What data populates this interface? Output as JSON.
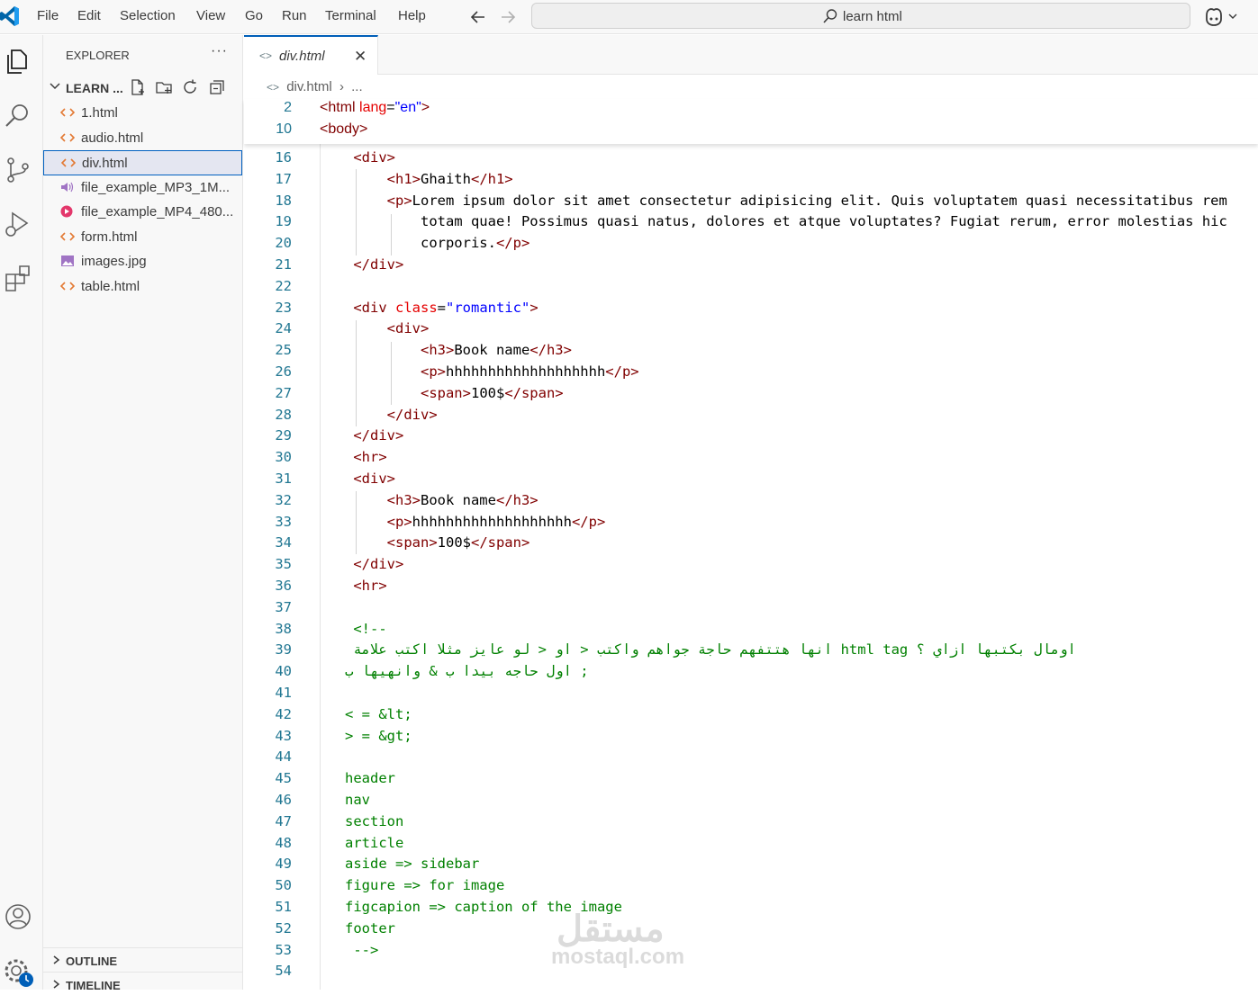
{
  "app": {
    "search_text": "learn html"
  },
  "menu": [
    "File",
    "Edit",
    "Selection",
    "View",
    "Go",
    "Run",
    "Terminal",
    "Help"
  ],
  "explorer": {
    "title": "EXPLORER",
    "more": "···",
    "folder": "LEARN ...",
    "files": [
      {
        "name": "1.html",
        "icon": "html-file-icon"
      },
      {
        "name": "audio.html",
        "icon": "html-file-icon"
      },
      {
        "name": "div.html",
        "icon": "html-file-icon",
        "selected": true
      },
      {
        "name": "file_example_MP3_1M...",
        "icon": "audio-file-icon"
      },
      {
        "name": "file_example_MP4_480...",
        "icon": "video-file-icon"
      },
      {
        "name": "form.html",
        "icon": "html-file-icon"
      },
      {
        "name": "images.jpg",
        "icon": "image-file-icon"
      },
      {
        "name": "table.html",
        "icon": "html-file-icon"
      }
    ],
    "outline": "OUTLINE",
    "timeline": "TIMELINE"
  },
  "tab": {
    "label": "div.html",
    "icon": "<>",
    "close": "✕"
  },
  "breadcrumb": {
    "file": "div.html",
    "sep": "›",
    "rest": "..."
  },
  "sticky_lines": [
    {
      "n": "2",
      "html": "<span class=\"t\">&lt;html</span> <span class=\"a\">lang</span>=<span class=\"s\">\"en\"</span><span class=\"t\">&gt;</span>"
    },
    {
      "n": "10",
      "html": "<span class=\"t\">&lt;body&gt;</span>"
    }
  ],
  "code_lines": [
    {
      "n": "16",
      "html": "    <span class=\"t\">&lt;div&gt;</span>"
    },
    {
      "n": "17",
      "html": "        <span class=\"t\">&lt;h1&gt;</span>Ghaith<span class=\"t\">&lt;/h1&gt;</span>"
    },
    {
      "n": "18",
      "html": "        <span class=\"t\">&lt;p&gt;</span>Lorem ipsum dolor sit amet consectetur adipisicing elit. Quis voluptatem quasi necessitatibus rem"
    },
    {
      "n": "19",
      "html": "            totam quae! Possimus quasi natus, dolores et atque voluptates? Fugiat rerum, error molestias hic"
    },
    {
      "n": "20",
      "html": "            corporis.<span class=\"t\">&lt;/p&gt;</span>"
    },
    {
      "n": "21",
      "html": "    <span class=\"t\">&lt;/div&gt;</span>"
    },
    {
      "n": "22",
      "html": ""
    },
    {
      "n": "23",
      "html": "    <span class=\"t\">&lt;div</span> <span class=\"a\">class</span>=<span class=\"s\">\"romantic\"</span><span class=\"t\">&gt;</span>"
    },
    {
      "n": "24",
      "html": "        <span class=\"t\">&lt;div&gt;</span>"
    },
    {
      "n": "25",
      "html": "            <span class=\"t\">&lt;h3&gt;</span>Book name<span class=\"t\">&lt;/h3&gt;</span>"
    },
    {
      "n": "26",
      "html": "            <span class=\"t\">&lt;p&gt;</span>hhhhhhhhhhhhhhhhhhh<span class=\"t\">&lt;/p&gt;</span>"
    },
    {
      "n": "27",
      "html": "            <span class=\"t\">&lt;span&gt;</span>100$<span class=\"t\">&lt;/span&gt;</span>"
    },
    {
      "n": "28",
      "html": "        <span class=\"t\">&lt;/div&gt;</span>"
    },
    {
      "n": "29",
      "html": "    <span class=\"t\">&lt;/div&gt;</span>"
    },
    {
      "n": "30",
      "html": "    <span class=\"t\">&lt;hr&gt;</span>"
    },
    {
      "n": "31",
      "html": "    <span class=\"t\">&lt;div&gt;</span>"
    },
    {
      "n": "32",
      "html": "        <span class=\"t\">&lt;h3&gt;</span>Book name<span class=\"t\">&lt;/h3&gt;</span>"
    },
    {
      "n": "33",
      "html": "        <span class=\"t\">&lt;p&gt;</span>hhhhhhhhhhhhhhhhhhh<span class=\"t\">&lt;/p&gt;</span>"
    },
    {
      "n": "34",
      "html": "        <span class=\"t\">&lt;span&gt;</span>100$<span class=\"t\">&lt;/span&gt;</span>"
    },
    {
      "n": "35",
      "html": "    <span class=\"t\">&lt;/div&gt;</span>"
    },
    {
      "n": "36",
      "html": "    <span class=\"t\">&lt;hr&gt;</span>"
    },
    {
      "n": "37",
      "html": ""
    },
    {
      "n": "38",
      "html": "    <span class=\"c\">&lt;!--</span>"
    },
    {
      "n": "39",
      "html": "    <span class=\"c\">انها هتتفهم حاجة جواهم واكتب &lt; او &lt; لو عايز مثلا اكتب علامة html tag اومال بكتبها ازاي ؟</span>"
    },
    {
      "n": "40",
      "html": "   <span class=\"c\">اول حاجه بيدا ب &amp; وانهيها ب ;</span>"
    },
    {
      "n": "41",
      "html": ""
    },
    {
      "n": "42",
      "html": "   <span class=\"c\">&lt; = &amp;lt;</span>"
    },
    {
      "n": "43",
      "html": "   <span class=\"c\">&gt; = &amp;gt;</span>"
    },
    {
      "n": "44",
      "html": ""
    },
    {
      "n": "45",
      "html": "   <span class=\"c\">header</span>"
    },
    {
      "n": "46",
      "html": "   <span class=\"c\">nav</span>"
    },
    {
      "n": "47",
      "html": "   <span class=\"c\">section</span>"
    },
    {
      "n": "48",
      "html": "   <span class=\"c\">article</span>"
    },
    {
      "n": "49",
      "html": "   <span class=\"c\">aside =&gt; sidebar</span>"
    },
    {
      "n": "50",
      "html": "   <span class=\"c\">figure =&gt; for image</span>"
    },
    {
      "n": "51",
      "html": "   <span class=\"c\">figcapion =&gt; caption of the image</span>"
    },
    {
      "n": "52",
      "html": "   <span class=\"c\">footer</span>"
    },
    {
      "n": "53",
      "html": "    <span class=\"c\">--&gt;</span>"
    },
    {
      "n": "54",
      "html": ""
    }
  ],
  "watermark": {
    "arabic": "مستقل",
    "latin": "mostaql.com"
  },
  "colors": {
    "accent": "#005fb8",
    "tag": "#800000",
    "attr": "#e50000",
    "string": "#0000ff",
    "comment": "#008000",
    "line_number": "#237893"
  }
}
